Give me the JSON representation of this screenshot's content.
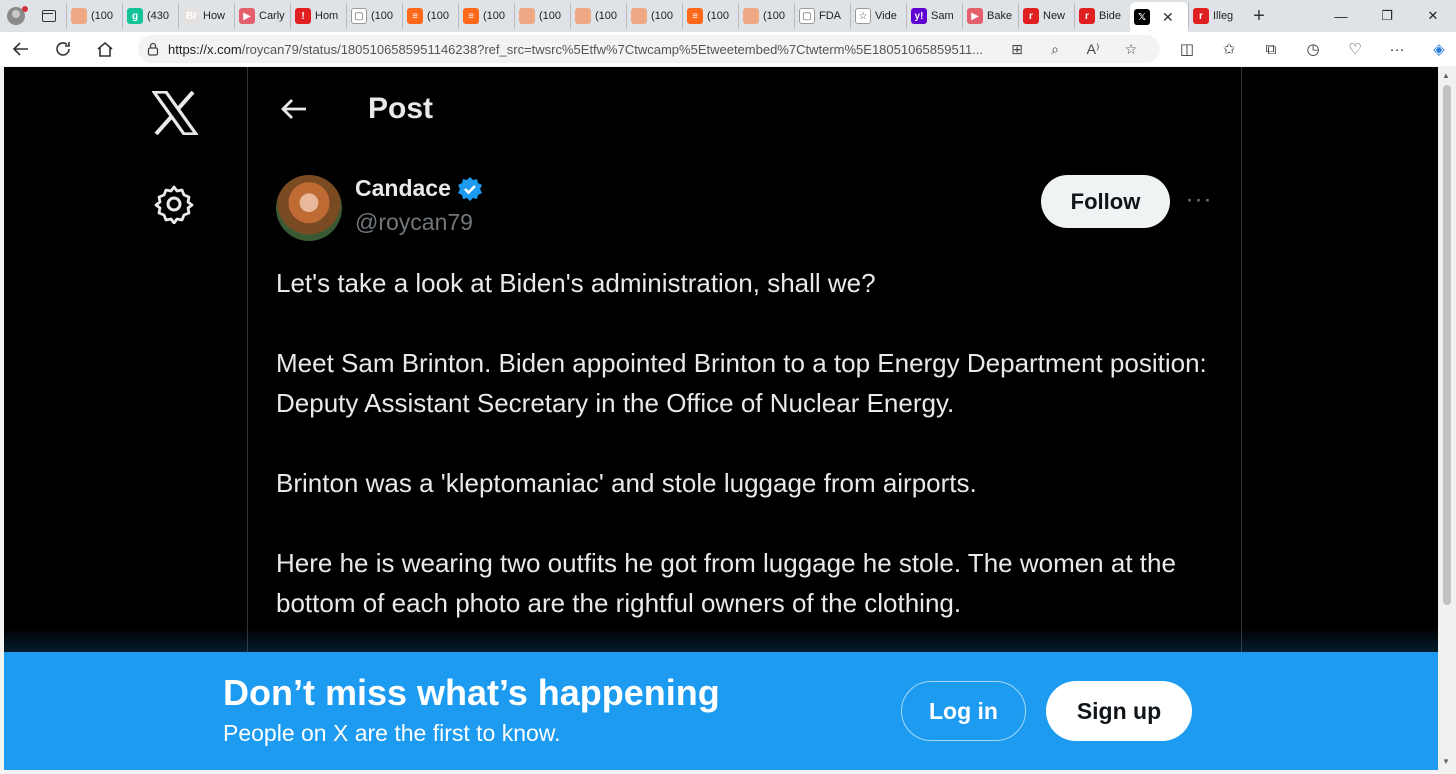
{
  "browser": {
    "tabs": [
      {
        "label": "(100",
        "fav_color": "#f0a884",
        "fav_text": ""
      },
      {
        "label": "(430",
        "fav_color": "#15c39a",
        "fav_text": "g"
      },
      {
        "label": "How",
        "fav_color": "#e8e0de",
        "fav_text": "BI"
      },
      {
        "label": "Carly",
        "fav_color": "#e4606d",
        "fav_text": "▶"
      },
      {
        "label": "Hom",
        "fav_color": "#e02020",
        "fav_text": "!"
      },
      {
        "label": "(100",
        "fav_color": "#ffffff",
        "fav_text": "▢"
      },
      {
        "label": "(100",
        "fav_color": "#ff6719",
        "fav_text": "≡"
      },
      {
        "label": "(100",
        "fav_color": "#ff6719",
        "fav_text": "≡"
      },
      {
        "label": "(100",
        "fav_color": "#f0a884",
        "fav_text": ""
      },
      {
        "label": "(100",
        "fav_color": "#f0a884",
        "fav_text": ""
      },
      {
        "label": "(100",
        "fav_color": "#f0a884",
        "fav_text": ""
      },
      {
        "label": "(100",
        "fav_color": "#ff6719",
        "fav_text": "≡"
      },
      {
        "label": "(100",
        "fav_color": "#f0a884",
        "fav_text": ""
      },
      {
        "label": "FDA",
        "fav_color": "#ffffff",
        "fav_text": "▢"
      },
      {
        "label": "Vide",
        "fav_color": "#ffffff",
        "fav_text": "☆"
      },
      {
        "label": "Sam",
        "fav_color": "#6001d2",
        "fav_text": "y!"
      },
      {
        "label": "Bake",
        "fav_color": "#e4606d",
        "fav_text": "▶"
      },
      {
        "label": "New",
        "fav_color": "#e02020",
        "fav_text": "r"
      },
      {
        "label": "Bide",
        "fav_color": "#e02020",
        "fav_text": "r"
      },
      {
        "label": "",
        "fav_color": "#000000",
        "fav_text": "𝕏",
        "active": true
      },
      {
        "label": "Illeg",
        "fav_color": "#e02020",
        "fav_text": "r"
      }
    ],
    "url_host": "https://x.com",
    "url_path": "/roycan79/status/1805106585951146238?ref_src=twsrc%5Etfw%7Ctwcamp%5Etweetembed%7Ctwterm%5E18051065859511..."
  },
  "header": {
    "title": "Post"
  },
  "author": {
    "name": "Candace",
    "handle": "@roycan79"
  },
  "follow_label": "Follow",
  "more_label": "···",
  "post": {
    "p1": "Let's take a look at Biden's administration, shall we?",
    "p2": "Meet Sam Brinton. Biden appointed Brinton to a top Energy Department position: Deputy Assistant Secretary in the Office of Nuclear Energy.",
    "p3": "Brinton was a 'kleptomaniac' and stole luggage from airports.",
    "p4": "Here he is wearing two outfits he got from luggage he stole. The women at the bottom of each photo are the rightful owners of the clothing."
  },
  "banner": {
    "title": "Don’t miss what’s happening",
    "subtitle": "People on X are the first to know.",
    "login_label": "Log in",
    "signup_label": "Sign up"
  },
  "colors": {
    "accent": "#1d9bf0",
    "background": "#000000",
    "text": "#e7e9ea",
    "muted": "#71767b"
  }
}
